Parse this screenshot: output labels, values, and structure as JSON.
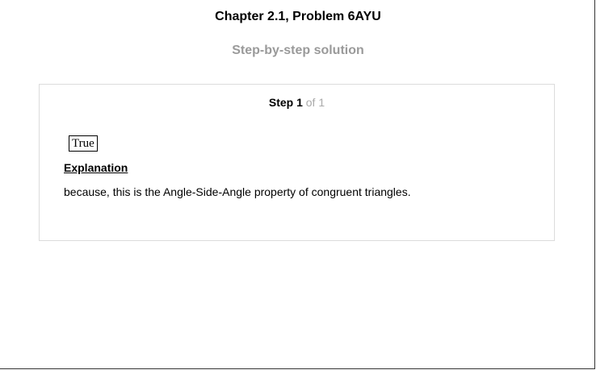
{
  "header": {
    "title": "Chapter 2.1, Problem 6AYU",
    "subtitle": "Step-by-step solution"
  },
  "step": {
    "label": "Step 1",
    "of_label": "of 1",
    "answer": "True",
    "explanation_heading": "Explanation",
    "explanation_text": "because, this is the Angle-Side-Angle property of congruent triangles."
  }
}
